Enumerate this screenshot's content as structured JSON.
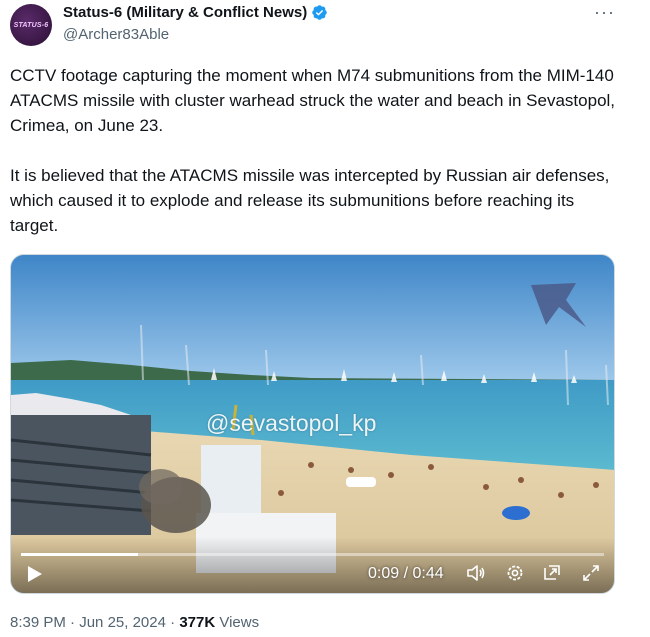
{
  "author": {
    "avatar_text": "STATUS-6",
    "display_name": "Status-6 (Military & Conflict News)",
    "handle": "@Archer83Able",
    "verified": true
  },
  "more_icon": "more-options-icon",
  "tweet": {
    "paragraphs": [
      "CCTV footage capturing the moment when M74 submunitions from the MIM-140 ATACMS missile with cluster warhead struck the water and beach in Sevastopol, Crimea, on June 23.",
      "It is believed that the ATACMS missile was intercepted by Russian air defenses, which caused it to explode and release its submunitions before reaching its target."
    ]
  },
  "video": {
    "watermark": "@sevastopol_kp",
    "time_display": "0:09 / 0:44",
    "progress_fraction": 0.2,
    "icons": [
      "play-icon",
      "volume-icon",
      "settings-icon",
      "pip-icon",
      "fullscreen-icon"
    ]
  },
  "meta": {
    "time": "8:39 PM",
    "separator": "·",
    "date": "Jun 25, 2024",
    "views_count": "377K",
    "views_label": "Views"
  },
  "colors": {
    "verified": "#1d9bf0",
    "secondary_text": "#536471",
    "primary_text": "#0f1419"
  }
}
